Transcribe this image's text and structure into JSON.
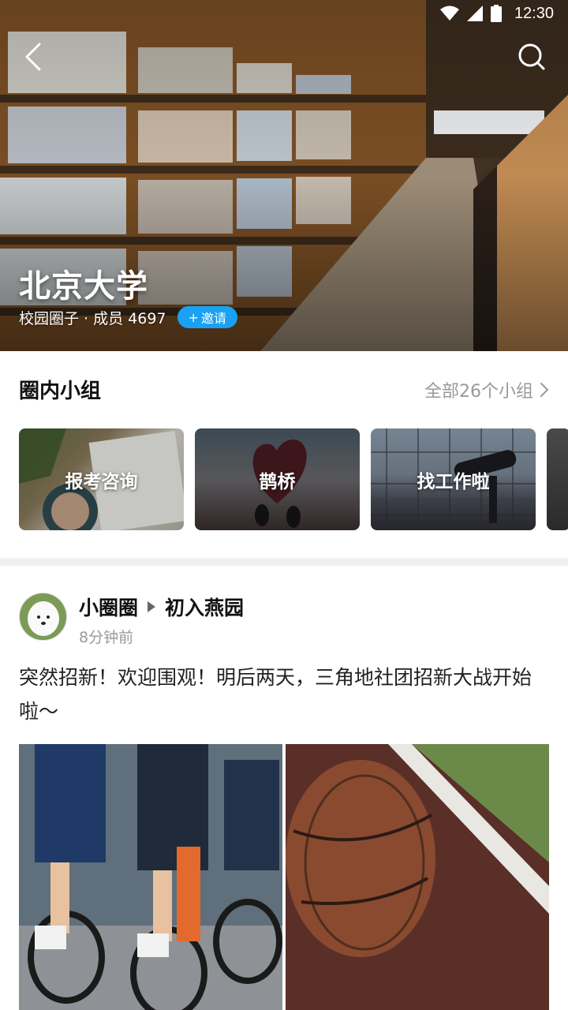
{
  "status_bar": {
    "time": "12:30"
  },
  "hero": {
    "title": "北京大学",
    "subtitle": "校园圈子 · 成员 4697",
    "invite_label": "邀请",
    "invite_icon": "+"
  },
  "groups": {
    "title": "圈内小组",
    "all_link": "全部26个小组",
    "cards": [
      {
        "label": "报考咨询"
      },
      {
        "label": "鹊桥"
      },
      {
        "label": "找工作啦"
      },
      {
        "label": ""
      }
    ]
  },
  "post": {
    "author": "小圈圈",
    "group": "初入燕园",
    "time": "8分钟前",
    "text": "突然招新！欢迎围观！明后两天，三角地社团招新大战开始啦～"
  }
}
